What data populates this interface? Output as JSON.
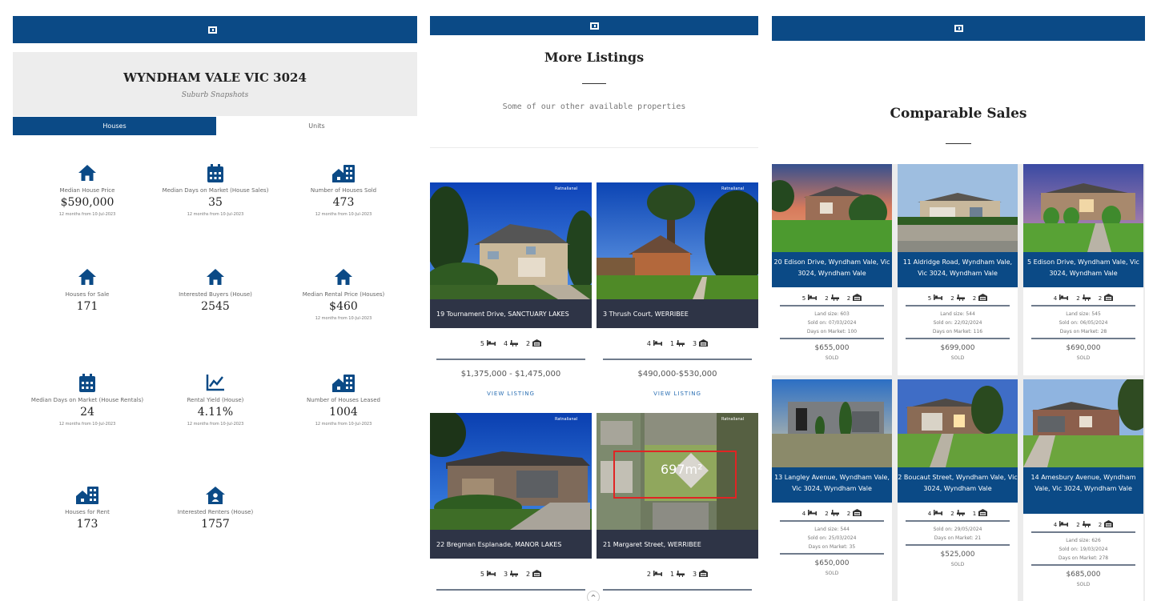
{
  "colors": {
    "navy": "#0b4a86",
    "address_bar": "#2e3446",
    "link": "#2a6fb3"
  },
  "snapshot": {
    "title": "WYNDHAM VALE VIC 3024",
    "subtitle": "Suburb Snapshots",
    "tabs": [
      {
        "label": "Houses",
        "active": true
      },
      {
        "label": "Units",
        "active": false
      }
    ],
    "stats": [
      {
        "icon": "house-icon",
        "label": "Median House Price",
        "value": "$590,000",
        "note": "12 months from 10-Jul-2023"
      },
      {
        "icon": "calendar-icon",
        "label": "Median Days on Market (House Sales)",
        "value": "35",
        "note": "12 months from 10-Jul-2023"
      },
      {
        "icon": "buildings-icon",
        "label": "Number of Houses Sold",
        "value": "473",
        "note": "12 months from 10-Jul-2023"
      },
      {
        "icon": "house-icon",
        "label": "Houses for Sale",
        "value": "171",
        "note": ""
      },
      {
        "icon": "house-icon",
        "label": "Interested Buyers (House)",
        "value": "2545",
        "note": ""
      },
      {
        "icon": "house-icon",
        "label": "Median Rental Price (Houses)",
        "value": "$460",
        "note": "12 months from 10-Jul-2023"
      },
      {
        "icon": "calendar-icon",
        "label": "Median Days on Market (House Rentals)",
        "value": "24",
        "note": "12 months from 10-Jul-2023"
      },
      {
        "icon": "chart-line-icon",
        "label": "Rental Yield (House)",
        "value": "4.11%",
        "note": "12 months from 10-Jul-2023"
      },
      {
        "icon": "buildings-icon",
        "label": "Number of Houses Leased",
        "value": "1004",
        "note": "12 months from 10-Jul-2023"
      },
      {
        "icon": "buildings-icon",
        "label": "Houses for Rent",
        "value": "173",
        "note": ""
      },
      {
        "icon": "house-person-icon",
        "label": "Interested Renters (House)",
        "value": "1757",
        "note": ""
      }
    ]
  },
  "more_listings": {
    "title": "More Listings",
    "subtitle": "Some of our other available properties",
    "brand_chip": "Ratnalianal",
    "view_label": "VIEW LISTING",
    "scroll_label": "^",
    "listings": [
      {
        "address": "19 Tournament Drive, SANCTUARY LAKES",
        "beds": "5",
        "baths": "4",
        "cars": "2",
        "price": "$1,375,000 - $1,475,000"
      },
      {
        "address": "3 Thrush Court, WERRIBEE",
        "beds": "4",
        "baths": "1",
        "cars": "3",
        "price": "$490,000-$530,000"
      },
      {
        "address": "22 Bregman Esplanade, MANOR LAKES",
        "beds": "5",
        "baths": "3",
        "cars": "2",
        "price": ""
      },
      {
        "address": "21 Margaret Street, WERRIBEE",
        "beds": "2",
        "baths": "1",
        "cars": "3",
        "price": "",
        "overlay": "697m²"
      }
    ]
  },
  "comparable_sales": {
    "title": "Comparable Sales",
    "items": [
      {
        "address": "20 Edison Drive, Wyndham Vale, Vic 3024, Wyndham Vale",
        "beds": "5",
        "baths": "2",
        "cars": "2",
        "info": [
          "Land size: 603",
          "Sold on: 07/03/2024",
          "Days on Market: 100"
        ],
        "price": "$655,000",
        "status": "SOLD"
      },
      {
        "address": "11 Aldridge Road, Wyndham Vale, Vic 3024, Wyndham Vale",
        "beds": "5",
        "baths": "2",
        "cars": "2",
        "info": [
          "Land size: 544",
          "Sold on: 22/02/2024",
          "Days on Market: 116"
        ],
        "price": "$699,000",
        "status": "SOLD"
      },
      {
        "address": "5 Edison Drive, Wyndham Vale, Vic 3024, Wyndham Vale",
        "beds": "4",
        "baths": "2",
        "cars": "2",
        "info": [
          "Land size: 545",
          "Sold on: 06/05/2024",
          "Days on Market: 28"
        ],
        "price": "$690,000",
        "status": "SOLD"
      },
      {
        "address": "13 Langley Avenue, Wyndham Vale, Vic 3024, Wyndham Vale",
        "beds": "4",
        "baths": "2",
        "cars": "2",
        "info": [
          "Land size: 544",
          "Sold on: 25/03/2024",
          "Days on Market: 35"
        ],
        "price": "$650,000",
        "status": "SOLD"
      },
      {
        "address": "2 Boucaut Street, Wyndham Vale, Vic 3024, Wyndham Vale",
        "beds": "4",
        "baths": "2",
        "cars": "1",
        "info": [
          "Sold on: 29/05/2024",
          "Days on Market: 21"
        ],
        "price": "$525,000",
        "status": "SOLD"
      },
      {
        "address": "14 Amesbury Avenue, Wyndham Vale, Vic 3024, Wyndham Vale",
        "beds": "4",
        "baths": "2",
        "cars": "2",
        "info": [
          "Land size: 626",
          "Sold on: 19/03/2024",
          "Days on Market: 278"
        ],
        "price": "$685,000",
        "status": "SOLD"
      }
    ]
  }
}
